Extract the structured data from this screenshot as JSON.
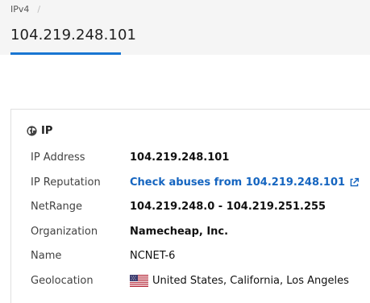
{
  "breadcrumb": {
    "first": "IPv4",
    "separator": "/"
  },
  "header": {
    "title": "104.219.248.101"
  },
  "panel": {
    "title": "IP",
    "rows": [
      {
        "label": "IP Address",
        "value": "104.219.248.101"
      },
      {
        "label": "IP Reputation",
        "value": "Check abuses from 104.219.248.101"
      },
      {
        "label": "NetRange",
        "value": "104.219.248.0 - 104.219.251.255"
      },
      {
        "label": "Organization",
        "value": "Namecheap, Inc."
      },
      {
        "label": "Name",
        "value": "NCNET-6"
      },
      {
        "label": "Geolocation",
        "value": "United States, California, Los Angeles"
      }
    ]
  },
  "icons": {
    "panel": "globe-icon",
    "reputation_link": "external-link-icon",
    "geolocation": "us-flag-icon"
  },
  "colors": {
    "accent": "#1976d2",
    "link": "#1565c0",
    "header_bg": "#f5f5f5"
  }
}
